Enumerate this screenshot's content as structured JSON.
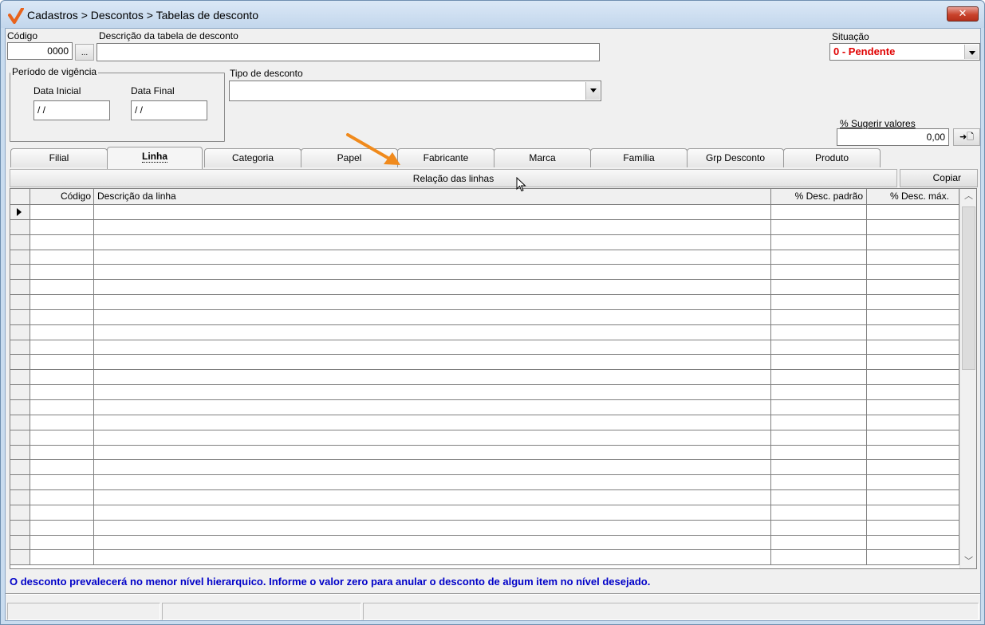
{
  "window": {
    "title": "Cadastros > Descontos > Tabelas de desconto",
    "close_label": "✕"
  },
  "form": {
    "codigo_label": "Código",
    "codigo_value": "0000",
    "lookup_button": "...",
    "descricao_label": "Descrição da tabela de desconto",
    "descricao_value": "",
    "situacao_label": "Situação",
    "situacao_value": "0 - Pendente",
    "periodo_label": "Período de vigência",
    "data_inicial_label": "Data Inicial",
    "data_inicial_value": "/ /",
    "data_final_label": "Data Final",
    "data_final_value": "/ /",
    "tipo_desconto_label": "Tipo de desconto",
    "tipo_desconto_value": "",
    "sugerir_label": "% Sugerir valores",
    "sugerir_value": "0,00",
    "sugerir_button": "➜🗋"
  },
  "tabs": [
    {
      "label": "Filial",
      "active": false
    },
    {
      "label": "Linha",
      "active": true
    },
    {
      "label": "Categoria",
      "active": false
    },
    {
      "label": "Papel",
      "active": false
    },
    {
      "label": "Fabricante",
      "active": false
    },
    {
      "label": "Marca",
      "active": false
    },
    {
      "label": "Família",
      "active": false
    },
    {
      "label": "Grp Desconto",
      "active": false
    },
    {
      "label": "Produto",
      "active": false
    }
  ],
  "section": {
    "title": "Relação das linhas",
    "copy_button": "Copiar"
  },
  "grid": {
    "columns": [
      "Código",
      "Descrição da linha",
      "% Desc. padrão",
      "% Desc. máx."
    ],
    "row_count": 24
  },
  "hint_text": "O desconto prevalecerá no menor nível hierarquico. Informe o valor zero para anular o desconto de algum item no nível desejado.",
  "colors": {
    "situacao": "#e00000",
    "hint": "#0000c8",
    "accent_arrow": "#f08a1c"
  }
}
